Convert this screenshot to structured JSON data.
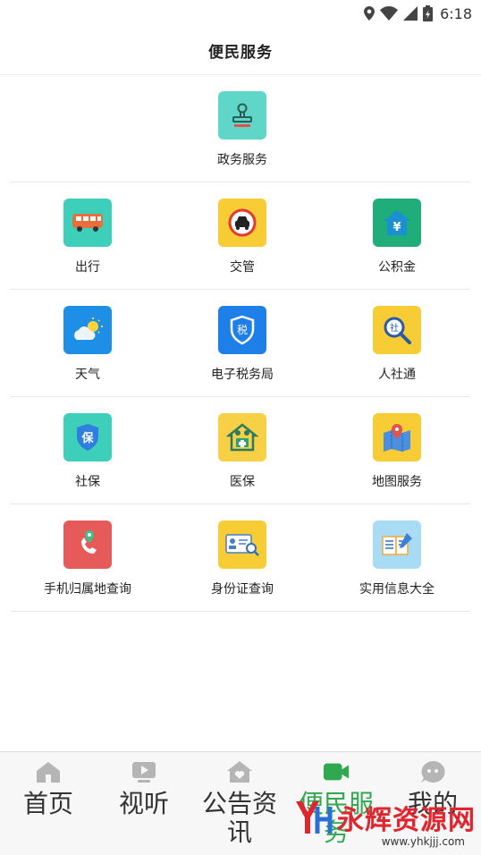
{
  "status_bar": {
    "time": "6:18"
  },
  "header": {
    "title": "便民服务"
  },
  "services": {
    "featured": {
      "label": "政务服务",
      "icon": "stamp-icon"
    },
    "rows": [
      [
        {
          "label": "出行",
          "icon": "bus-icon"
        },
        {
          "label": "交管",
          "icon": "traffic-car-icon"
        },
        {
          "label": "公积金",
          "icon": "housing-fund-icon"
        }
      ],
      [
        {
          "label": "天气",
          "icon": "weather-icon"
        },
        {
          "label": "电子税务局",
          "icon": "tax-shield-icon"
        },
        {
          "label": "人社通",
          "icon": "social-search-icon"
        }
      ],
      [
        {
          "label": "社保",
          "icon": "social-security-shield-icon"
        },
        {
          "label": "医保",
          "icon": "medical-insurance-icon"
        },
        {
          "label": "地图服务",
          "icon": "map-pin-icon"
        }
      ],
      [
        {
          "label": "手机归属地查询",
          "icon": "phone-location-icon"
        },
        {
          "label": "身份证查询",
          "icon": "id-card-search-icon"
        },
        {
          "label": "实用信息大全",
          "icon": "info-book-icon"
        }
      ]
    ]
  },
  "bottom_nav": {
    "items": [
      {
        "label": "首页",
        "icon": "home-icon"
      },
      {
        "label": "视听",
        "icon": "play-icon"
      },
      {
        "label": "公告资讯",
        "icon": "house-heart-icon"
      },
      {
        "label": "便民服务",
        "icon": "video-camera-icon"
      },
      {
        "label": "我的",
        "icon": "profile-face-icon"
      }
    ],
    "active_index": 3
  },
  "watermark": {
    "logo_text": "YH",
    "brand": "永辉资源网",
    "url": "www.yhkjjj.com"
  },
  "colors": {
    "active_tab": "#2fa84f",
    "watermark_red": "#e0252f"
  }
}
